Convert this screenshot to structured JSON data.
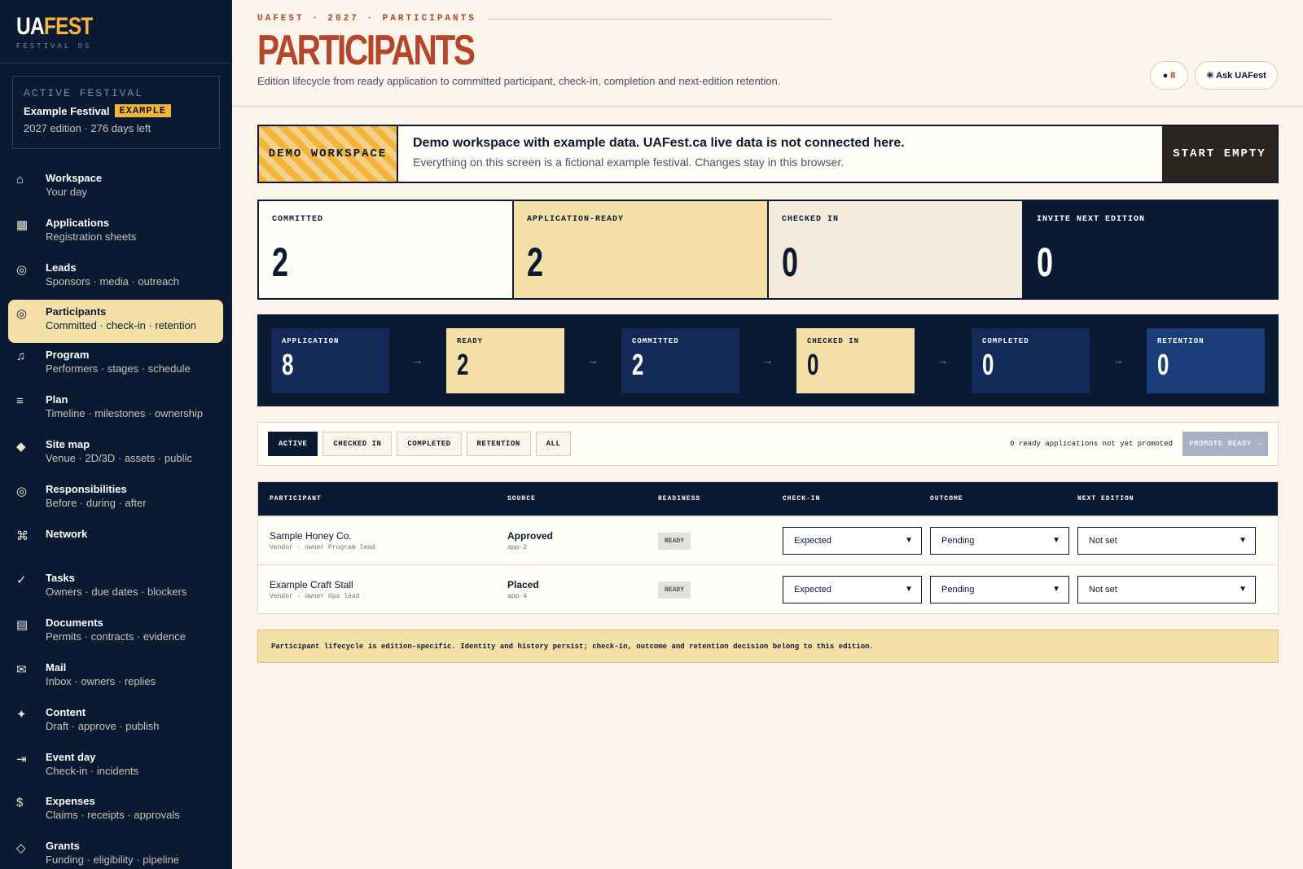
{
  "brand": {
    "logo_ua": "UA",
    "logo_fest": "FEST",
    "subtitle": "FESTIVAL OS"
  },
  "festival": {
    "label": "ACTIVE FESTIVAL",
    "name": "Example Festival",
    "badge": "EXAMPLE",
    "edition": "2027 edition · 276 days left"
  },
  "nav": [
    {
      "icon": "home-icon",
      "glyph": "⌂",
      "title": "Workspace",
      "sub": "Your day"
    },
    {
      "icon": "grid-icon",
      "glyph": "▦",
      "title": "Applications",
      "sub": "Registration sheets"
    },
    {
      "icon": "target-icon",
      "glyph": "◎",
      "title": "Leads",
      "sub": "Sponsors · media · outreach"
    },
    {
      "icon": "target-icon",
      "glyph": "◎",
      "title": "Participants",
      "sub": "Committed · check-in · retention"
    },
    {
      "icon": "music-icon",
      "glyph": "♫",
      "title": "Program",
      "sub": "Performers · stages · schedule"
    },
    {
      "icon": "list-icon",
      "glyph": "≡",
      "title": "Plan",
      "sub": "Timeline · milestones · ownership"
    },
    {
      "icon": "diamond-icon",
      "glyph": "◆",
      "title": "Site map",
      "sub": "Venue · 2D/3D · assets · public"
    },
    {
      "icon": "target-icon",
      "glyph": "◎",
      "title": "Responsibilities",
      "sub": "Before · during · after"
    },
    {
      "icon": "command-icon",
      "glyph": "⌘",
      "title": "Network",
      "sub": ""
    },
    {
      "icon": "check-icon",
      "glyph": "✓",
      "title": "Tasks",
      "sub": "Owners · due dates · blockers"
    },
    {
      "icon": "document-icon",
      "glyph": "▤",
      "title": "Documents",
      "sub": "Permits · contracts · evidence"
    },
    {
      "icon": "mail-icon",
      "glyph": "✉",
      "title": "Mail",
      "sub": "Inbox · owners · replies"
    },
    {
      "icon": "sparkle-icon",
      "glyph": "✦",
      "title": "Content",
      "sub": "Draft · approve · publish"
    },
    {
      "icon": "enter-icon",
      "glyph": "⇥",
      "title": "Event day",
      "sub": "Check-in · incidents"
    },
    {
      "icon": "dollar-icon",
      "glyph": "$",
      "title": "Expenses",
      "sub": "Claims · receipts · approvals"
    },
    {
      "icon": "diamond-outline-icon",
      "glyph": "◇",
      "title": "Grants",
      "sub": "Funding · eligibility · pipeline"
    }
  ],
  "header": {
    "breadcrumb": "UAFEST · 2027 · PARTICIPANTS",
    "title": "PARTICIPANTS",
    "description": "Edition lifecycle from ready application to committed participant, check-in, completion and next-edition retention.",
    "count_dot": "●",
    "count": "8",
    "ask_label": "✳ Ask UAFest"
  },
  "demo": {
    "tag": "DEMO WORKSPACE",
    "title": "Demo workspace with example data. UAFest.ca live data is not connected here.",
    "subtitle": "Everything on this screen is a fictional example festival. Changes stay in this browser.",
    "button": "START EMPTY"
  },
  "kpis": [
    {
      "label": "COMMITTED",
      "value": "2",
      "bg": "#fffdf8",
      "fg": "#0b1a33"
    },
    {
      "label": "APPLICATION-READY",
      "value": "2",
      "bg": "#f5e0a8",
      "fg": "#0b1a33"
    },
    {
      "label": "CHECKED IN",
      "value": "0",
      "bg": "#f5ebdc",
      "fg": "#0b1a33"
    },
    {
      "label": "INVITE NEXT EDITION",
      "value": "0",
      "bg": "#0b1a33",
      "fg": "#ffffff"
    }
  ],
  "pipeline": [
    {
      "label": "APPLICATION",
      "value": "8",
      "style": "dark"
    },
    {
      "label": "READY",
      "value": "2",
      "style": "light"
    },
    {
      "label": "COMMITTED",
      "value": "2",
      "style": "dark"
    },
    {
      "label": "CHECKED IN",
      "value": "0",
      "style": "light"
    },
    {
      "label": "COMPLETED",
      "value": "0",
      "style": "dark"
    },
    {
      "label": "RETENTION",
      "value": "0",
      "style": "retention"
    }
  ],
  "pipeline_arrow": "→",
  "filters": {
    "tabs": [
      "ACTIVE",
      "CHECKED IN",
      "COMPLETED",
      "RETENTION",
      "ALL"
    ],
    "active_index": 0,
    "ready_note": "0 ready applications not yet promoted",
    "promote": "PROMOTE READY →"
  },
  "table": {
    "columns": [
      "PARTICIPANT",
      "SOURCE",
      "READINESS",
      "CHECK-IN",
      "OUTCOME",
      "NEXT EDITION"
    ],
    "rows": [
      {
        "name": "Sample Honey Co.",
        "meta": "Vendor · owner Program lead",
        "source": "Approved",
        "source_id": "app-2",
        "readiness": "READY",
        "checkin": "Expected",
        "outcome": "Pending",
        "next": "Not set"
      },
      {
        "name": "Example Craft Stall",
        "meta": "Vendor · owner Ops lead",
        "source": "Placed",
        "source_id": "app-4",
        "readiness": "READY",
        "checkin": "Expected",
        "outcome": "Pending",
        "next": "Not set"
      }
    ]
  },
  "note": "Participant lifecycle is edition-specific. Identity and history persist; check-in, outcome and retention decision belong to this edition."
}
